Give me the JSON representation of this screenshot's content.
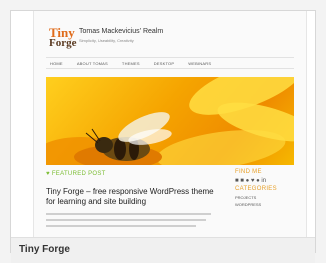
{
  "site": {
    "logo_line1": "Tiny",
    "logo_line2": "Forge",
    "title": "Tomas Mackevicius' Realm",
    "tagline": "Simplicity, Useability, Creativity"
  },
  "nav": [
    "HOME",
    "ABOUT TOMAS",
    "THEMES",
    "DESKTOP",
    "WEBINARS"
  ],
  "featured_label": "FEATURED POST",
  "post_title": "Tiny Forge – free responsive WordPress theme for learning and site building",
  "sidebar": {
    "find_me": "FIND ME",
    "social": "■ ■ ● ♥ ● in",
    "categories": "CATEGORIES",
    "cat1": "PROJECTS",
    "cat2": "WORDPRESS"
  },
  "caption": "Tiny Forge",
  "colors": {
    "accent_green": "#7bbd33",
    "accent_orange": "#e8a12b",
    "logo_orange": "#e06b1a"
  }
}
